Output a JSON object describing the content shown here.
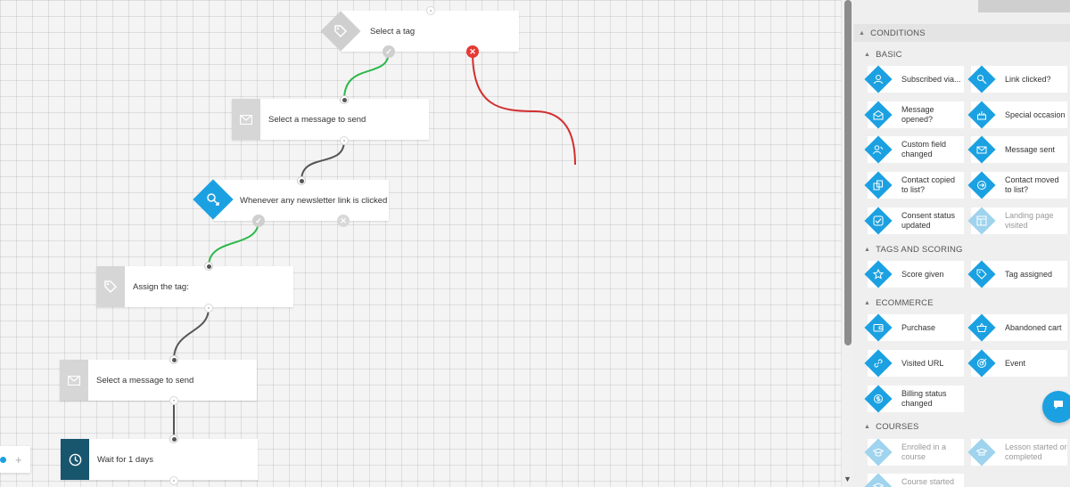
{
  "canvas": {
    "nodes": {
      "select_tag": "Select a tag",
      "select_message_1": "Select a message to send",
      "newsletter_click": "Whenever any newsletter link is clicked",
      "assign_tag": "Assign the tag:",
      "select_message_2": "Select a message to send",
      "wait": "Wait for 1 days"
    },
    "zoom_plus": "+",
    "wire_colors": {
      "yes": "#2db84b",
      "no": "#d32f2f",
      "default": "#555555"
    }
  },
  "panel": {
    "conditions_header": "CONDITIONS",
    "basic": {
      "title": "BASIC",
      "items": [
        {
          "label": "Subscribed via...",
          "icon": "user-icon"
        },
        {
          "label": "Link clicked?",
          "icon": "link-cursor-icon"
        },
        {
          "label": "Message opened?",
          "icon": "envelope-open-icon"
        },
        {
          "label": "Special occasion",
          "icon": "cake-icon"
        },
        {
          "label": "Custom field changed",
          "icon": "user-edit-icon"
        },
        {
          "label": "Message sent",
          "icon": "envelope-send-icon"
        },
        {
          "label": "Contact copied to list?",
          "icon": "copy-icon"
        },
        {
          "label": "Contact moved to list?",
          "icon": "move-icon"
        },
        {
          "label": "Consent status updated",
          "icon": "check-square-icon"
        },
        {
          "label": "Landing page visited",
          "icon": "landing-page-icon"
        }
      ]
    },
    "tags_scoring": {
      "title": "TAGS AND SCORING",
      "items": [
        {
          "label": "Score given",
          "icon": "star-icon"
        },
        {
          "label": "Tag assigned",
          "icon": "tag-icon"
        }
      ]
    },
    "ecommerce": {
      "title": "ECOMMERCE",
      "items": [
        {
          "label": "Purchase",
          "icon": "wallet-icon"
        },
        {
          "label": "Abandoned cart",
          "icon": "basket-icon"
        },
        {
          "label": "Visited URL",
          "icon": "url-link-icon"
        },
        {
          "label": "Event",
          "icon": "target-icon"
        },
        {
          "label": "Billing status changed",
          "icon": "billing-icon"
        }
      ]
    },
    "courses": {
      "title": "COURSES",
      "items": [
        {
          "label": "Enrolled in a course",
          "icon": "graduation-cap-icon"
        },
        {
          "label": "Lesson started or completed",
          "icon": "lesson-icon"
        },
        {
          "label": "Course started",
          "icon": "course-icon"
        }
      ]
    }
  },
  "colors": {
    "accent": "#1ba1e2",
    "dark_tile": "#18566e",
    "error": "#e53935"
  }
}
